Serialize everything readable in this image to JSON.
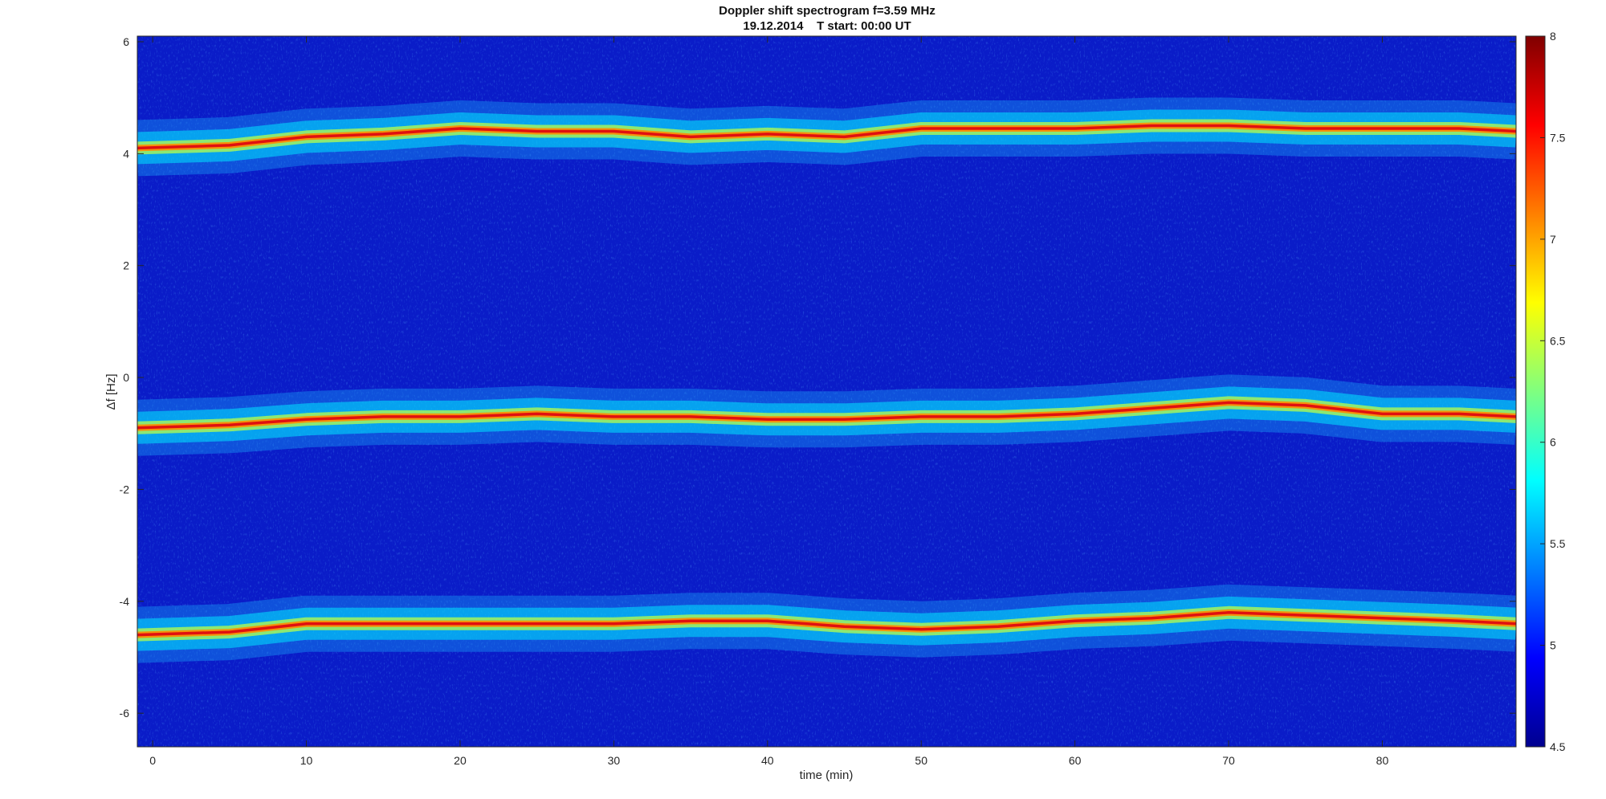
{
  "chart_data": {
    "type": "heatmap",
    "title": "Doppler shift spectrogram f=3.59 MHz",
    "subtitle": "19.12.2014    T start: 00:00 UT",
    "xlabel": "time (min)",
    "ylabel": "Δf [Hz]",
    "xlim": [
      -1,
      88.7
    ],
    "ylim": [
      -6.6,
      6.1
    ],
    "x_ticks": [
      0,
      10,
      20,
      30,
      40,
      50,
      60,
      70,
      80
    ],
    "y_ticks": [
      6,
      4,
      2,
      0,
      -2,
      -4,
      -6
    ],
    "colorbar": {
      "range": [
        4.5,
        8
      ],
      "ticks": [
        "8",
        "7.5",
        "7",
        "6.5",
        "6",
        "5.5",
        "5",
        "4.5"
      ],
      "colormap": "jet"
    },
    "traces": [
      {
        "x": [
          -1,
          5,
          10,
          15,
          20,
          25,
          30,
          35,
          40,
          45,
          50,
          55,
          60,
          65,
          70,
          75,
          80,
          85,
          88.7
        ],
        "df": [
          4.1,
          4.15,
          4.3,
          4.35,
          4.45,
          4.4,
          4.4,
          4.3,
          4.35,
          4.3,
          4.45,
          4.45,
          4.45,
          4.5,
          4.5,
          4.45,
          4.45,
          4.45,
          4.4
        ]
      },
      {
        "x": [
          -1,
          5,
          10,
          15,
          20,
          25,
          30,
          35,
          40,
          45,
          50,
          55,
          60,
          65,
          70,
          75,
          80,
          85,
          88.7
        ],
        "df": [
          -0.9,
          -0.85,
          -0.75,
          -0.7,
          -0.7,
          -0.65,
          -0.7,
          -0.7,
          -0.75,
          -0.75,
          -0.7,
          -0.7,
          -0.65,
          -0.55,
          -0.45,
          -0.5,
          -0.65,
          -0.65,
          -0.7
        ]
      },
      {
        "x": [
          -1,
          5,
          10,
          15,
          20,
          25,
          30,
          35,
          40,
          45,
          50,
          55,
          60,
          65,
          70,
          75,
          80,
          85,
          88.7
        ],
        "df": [
          -4.6,
          -4.55,
          -4.4,
          -4.4,
          -4.4,
          -4.4,
          -4.4,
          -4.35,
          -4.35,
          -4.45,
          -4.5,
          -4.45,
          -4.35,
          -4.3,
          -4.2,
          -4.25,
          -4.3,
          -4.35,
          -4.4
        ]
      }
    ]
  }
}
